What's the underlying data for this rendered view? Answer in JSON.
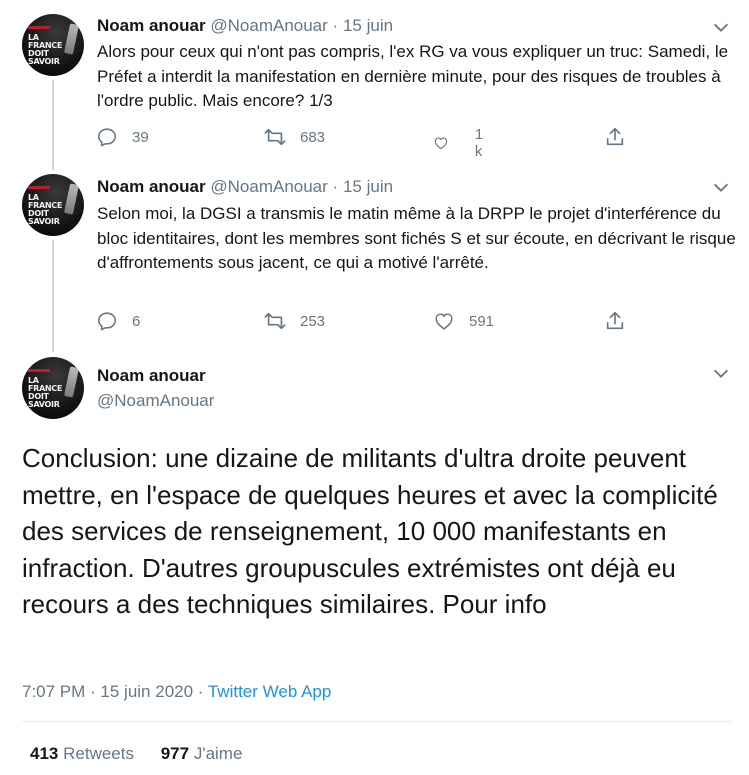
{
  "tweets": [
    {
      "name": "Noam anouar",
      "handle": "@NoamAnouar",
      "separator": "·",
      "date": "15 juin",
      "text": "Alors pour ceux qui n'ont pas compris, l'ex RG va vous expliquer un truc: Samedi, le Préfet a interdit la manifestation en dernière minute, pour des risques de troubles à l'ordre public. Mais encore? 1/3",
      "replies": "39",
      "retweets": "683",
      "likes": "1 k"
    },
    {
      "name": "Noam anouar",
      "handle": "@NoamAnouar",
      "separator": "·",
      "date": "15 juin",
      "text": "Selon moi, la DGSI a transmis le matin même à la DRPP le projet d'interférence du bloc identitaires, dont les membres sont fichés S et sur écoute, en décrivant le risque  d'affrontements sous jacent, ce qui a motivé l'arrêté.",
      "replies": "6",
      "retweets": "253",
      "likes": "591"
    }
  ],
  "main_tweet": {
    "name": "Noam anouar",
    "handle": "@NoamAnouar",
    "text": "Conclusion: une dizaine de militants d'ultra droite peuvent mettre, en l'espace de quelques heures et avec la complicité des services de renseignement, 10 000 manifestants en infraction. D'autres groupuscules extrémistes ont déjà eu recours a des techniques similaires.  Pour info",
    "time": "7:07 PM · 15 juin 2020 · ",
    "app": "Twitter Web App",
    "retweet_count": "413",
    "retweet_label": "Retweets",
    "like_count": "977",
    "like_label": "J'aime"
  },
  "avatar": {
    "lettering": "LA\nFRANCE\nDOIT\nSAVOIR"
  },
  "icons": [
    "chevron-down-icon",
    "reply-icon",
    "retweet-icon",
    "like-icon",
    "share-icon"
  ],
  "colors": {
    "text": "#14171a",
    "muted": "#657786",
    "link": "#1b95e0",
    "divider": "#e6ecf0"
  }
}
